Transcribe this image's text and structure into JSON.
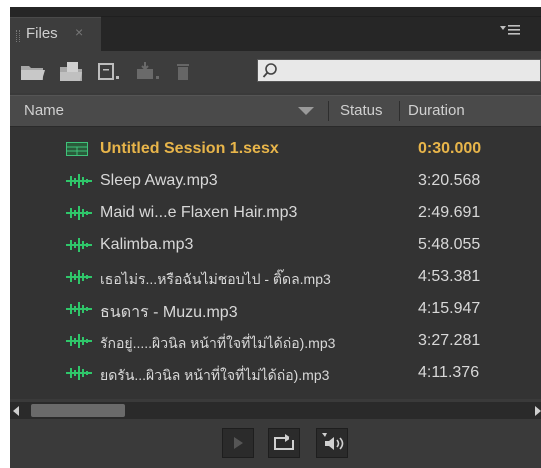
{
  "panel": {
    "tab_label": "Files",
    "tab_close_glyph": "×",
    "menu_icon": "panel-menu-icon"
  },
  "toolbar": {
    "tools": [
      "open-folder-icon",
      "import-file-icon",
      "new-file-icon",
      "insert-into-multitrack-icon",
      "delete-icon"
    ],
    "search_placeholder": ""
  },
  "table": {
    "columns": {
      "name": "Name",
      "status": "Status",
      "duration": "Duration"
    },
    "rows": [
      {
        "icon": "session-icon",
        "name": "Untitled Session 1.sesx",
        "duration": "0:30.000",
        "kind": "session"
      },
      {
        "icon": "waveform-icon",
        "name": "Sleep Away.mp3",
        "duration": "3:20.568",
        "kind": "audio"
      },
      {
        "icon": "waveform-icon",
        "name": "Maid wi...e Flaxen Hair.mp3",
        "duration": "2:49.691",
        "kind": "audio"
      },
      {
        "icon": "waveform-icon",
        "name": "Kalimba.mp3",
        "duration": "5:48.055",
        "kind": "audio"
      },
      {
        "icon": "waveform-icon",
        "name": "เธอไม่ร...หรือฉันไม่ชอบไป - ติ๊ดล.mp3",
        "duration": "4:53.381",
        "kind": "audio"
      },
      {
        "icon": "waveform-icon",
        "name": "ธนดาร -  Muzu.mp3",
        "duration": "4:15.947",
        "kind": "audio"
      },
      {
        "icon": "waveform-icon",
        "name": "รักอยู่.....ผิวนิล หน้าที่ใจที่ไม่ได้ถ่อ).mp3",
        "duration": "3:27.281",
        "kind": "audio"
      },
      {
        "icon": "waveform-icon",
        "name": "ยดรัน...ผิวนิล หน้าที่ใจที่ไม่ได้ถ่อ).mp3",
        "duration": "4:11.376",
        "kind": "audio"
      }
    ]
  },
  "controls": [
    "play-icon",
    "loop-icon",
    "autoplay-icon"
  ],
  "colors": {
    "session_text": "#e8b54a",
    "audio_icon": "#2fc66a",
    "panel_bg": "#333333"
  }
}
